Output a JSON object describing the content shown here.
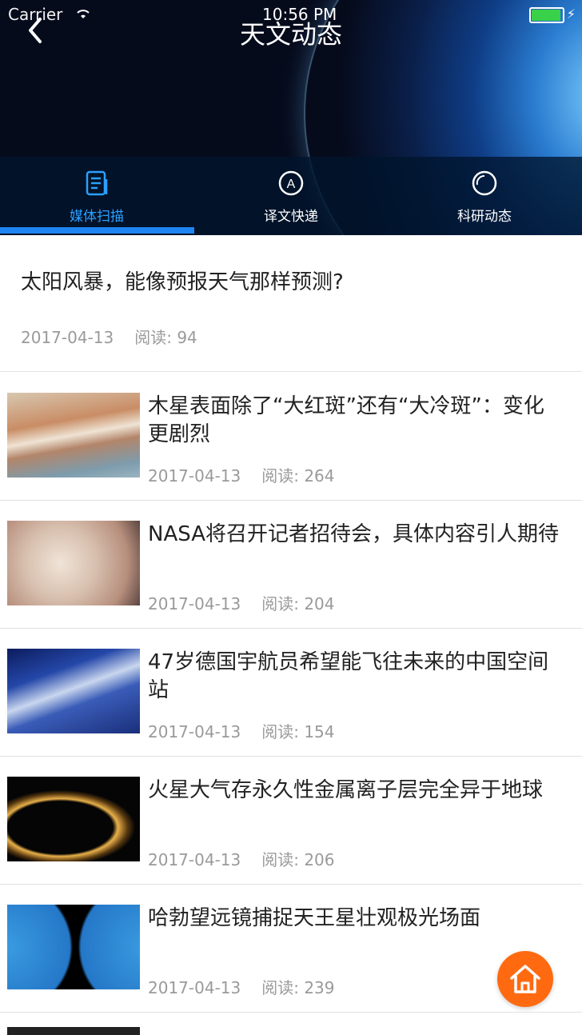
{
  "status": {
    "carrier": "Carrier",
    "time": "10:56 PM"
  },
  "header": {
    "title": "天文动态"
  },
  "tabs": [
    {
      "label": "媒体扫描",
      "icon": "document-icon",
      "active": true
    },
    {
      "label": "译文快递",
      "icon": "circle-a-icon",
      "active": false
    },
    {
      "label": "科研动态",
      "icon": "ring-icon",
      "active": false
    }
  ],
  "featured": {
    "title": "太阳风暴，能像预报天气那样预测?",
    "date": "2017-04-13",
    "views": "阅读: 94"
  },
  "articles": [
    {
      "title": "木星表面除了“大红斑”还有“大冷斑”：变化更剧烈",
      "date": "2017-04-13",
      "views": "阅读: 264"
    },
    {
      "title": "NASA将召开记者招待会，具体内容引人期待",
      "date": "2017-04-13",
      "views": "阅读: 204"
    },
    {
      "title": "47岁德国宇航员希望能飞往未来的中国空间站",
      "date": "2017-04-13",
      "views": "阅读: 154"
    },
    {
      "title": "火星大气存永久性金属离子层完全异于地球",
      "date": "2017-04-13",
      "views": "阅读: 206"
    },
    {
      "title": "哈勃望远镜捕捉天王星壮观极光场面",
      "date": "2017-04-13",
      "views": "阅读: 239"
    }
  ],
  "colors": {
    "accent": "#1e84f2",
    "home_button": "#ff6a10"
  }
}
